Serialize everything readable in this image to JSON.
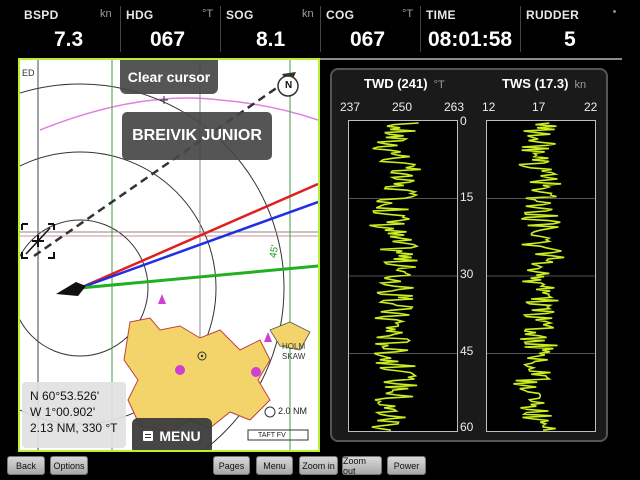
{
  "instruments": [
    {
      "label": "BSPD",
      "unit": "kn",
      "value": "7.3"
    },
    {
      "label": "HDG",
      "unit": "°T",
      "value": "067"
    },
    {
      "label": "SOG",
      "unit": "kn",
      "value": "8.1"
    },
    {
      "label": "COG",
      "unit": "°T",
      "value": "067"
    },
    {
      "label": "TIME",
      "unit": "",
      "value": "08:01:58"
    },
    {
      "label": "RUDDER",
      "unit": "",
      "value": "5"
    }
  ],
  "chart": {
    "clear_cursor_label": "Clear cursor",
    "vessel_name": "BREIVIK JUNIOR",
    "north_label": "N",
    "ed_label": "ED",
    "bearing_label": "45'",
    "place_labels": [
      "HOLM",
      "SKAW"
    ],
    "range_label": "2.0 NM",
    "scale_label": "TAFT FV",
    "position": {
      "lat": "N  60°53.526'",
      "lon": "W   1°00.902'",
      "range_bearing": "2.13 NM, 330 °T"
    },
    "menu_label": "MENU"
  },
  "wind": {
    "twd": {
      "title": "TWD (241)",
      "unit": "°T",
      "ticks": [
        "237",
        "250",
        "263"
      ]
    },
    "tws": {
      "title": "TWS (17.3)",
      "unit": "kn",
      "ticks": [
        "12",
        "17",
        "22"
      ]
    },
    "time_ticks": [
      "0",
      "15",
      "30",
      "45",
      "60"
    ],
    "trace_color": "#c8f020"
  },
  "toolbar": {
    "back": "Back",
    "options": "Options",
    "pages": "Pages",
    "menu": "Menu",
    "zoom_in": "Zoom in",
    "zoom_out": "Zoom out",
    "power": "Power"
  },
  "colors": {
    "chart_border": "#b9f032",
    "heading_line": "#e02020",
    "cog_line": "#2030e0",
    "bearing_line": "#20b020"
  }
}
